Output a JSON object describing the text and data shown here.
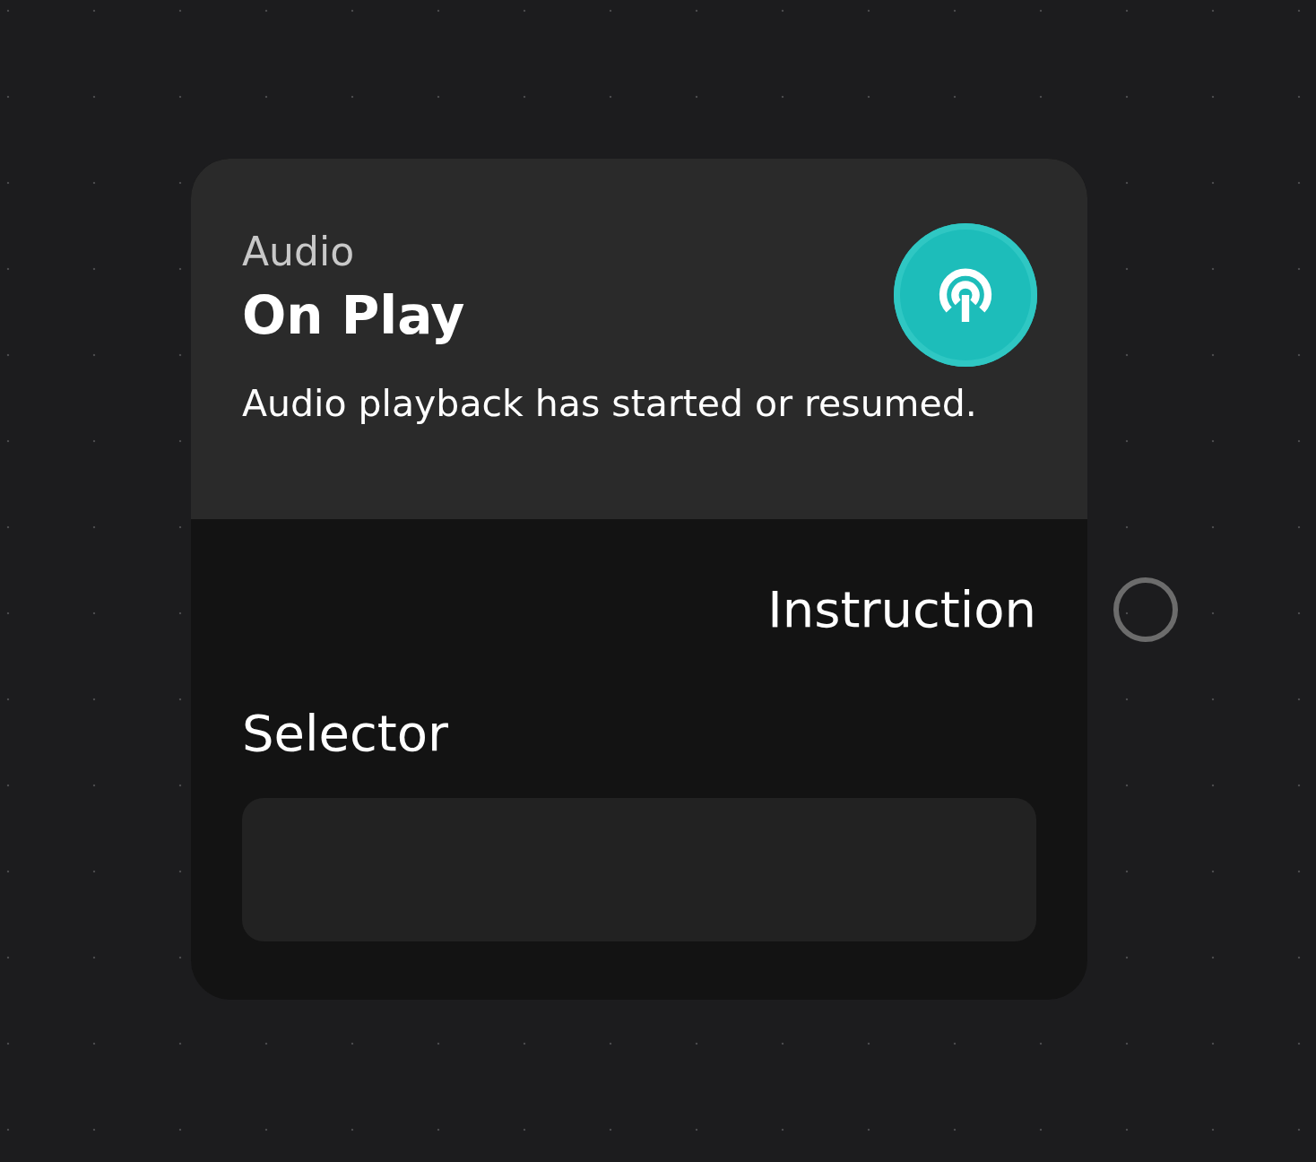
{
  "node": {
    "category": "Audio",
    "title": "On Play",
    "description": "Audio playback has started or resumed.",
    "outputs": [
      {
        "label": "Instruction"
      }
    ],
    "inputs": [
      {
        "label": "Selector",
        "kind": "text"
      }
    ]
  }
}
